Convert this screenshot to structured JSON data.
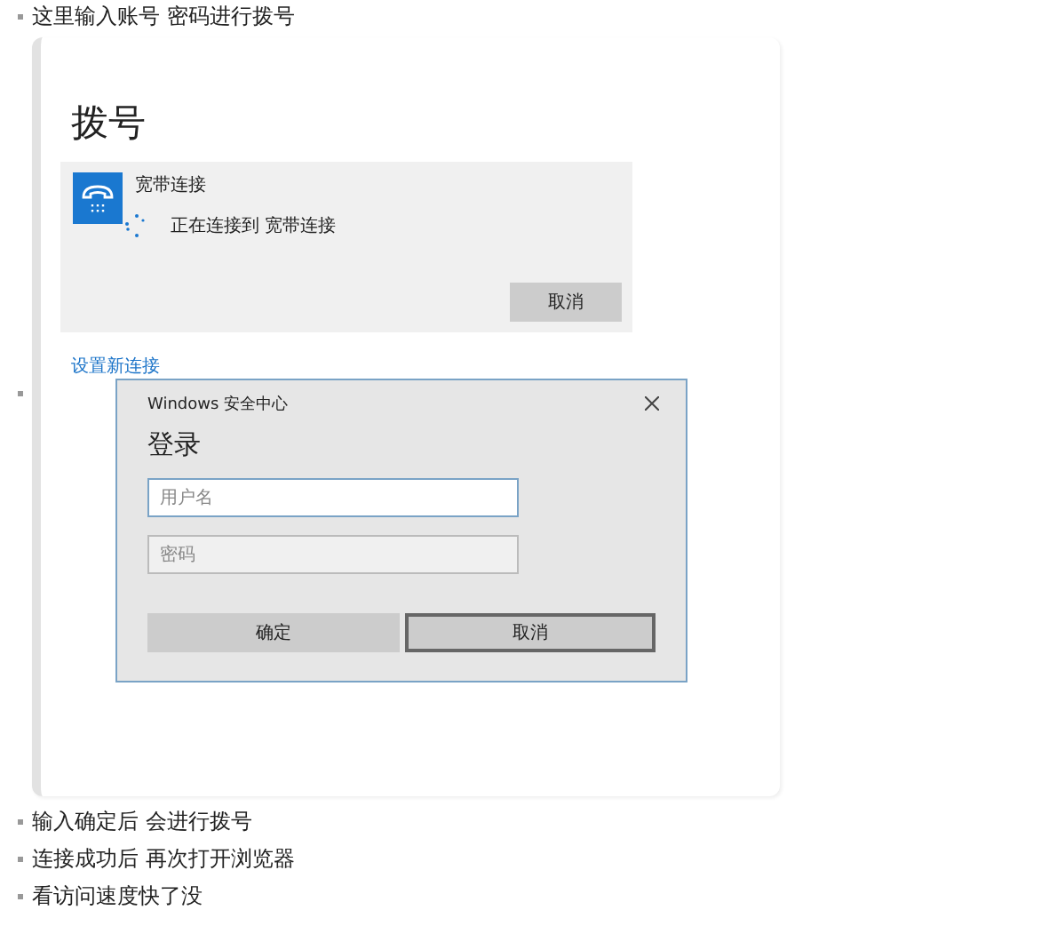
{
  "items": [
    {
      "kind": "text",
      "text": "这里输入账号 密码进行拨号"
    },
    {
      "kind": "screenshot",
      "dial": {
        "title": "拨号",
        "connection_name": "宽带连接",
        "status": "正在连接到 宽带连接",
        "cancel_button": "取消",
        "setup_link": "设置新连接"
      },
      "dialog": {
        "window_title": "Windows 安全中心",
        "heading": "登录",
        "username_placeholder": "用户名",
        "password_placeholder": "密码",
        "ok_button": "确定",
        "cancel_button": "取消"
      }
    },
    {
      "kind": "text",
      "text": "输入确定后 会进行拨号"
    },
    {
      "kind": "text",
      "text": "连接成功后 再次打开浏览器"
    },
    {
      "kind": "text",
      "text": "看访问速度快了没"
    }
  ]
}
